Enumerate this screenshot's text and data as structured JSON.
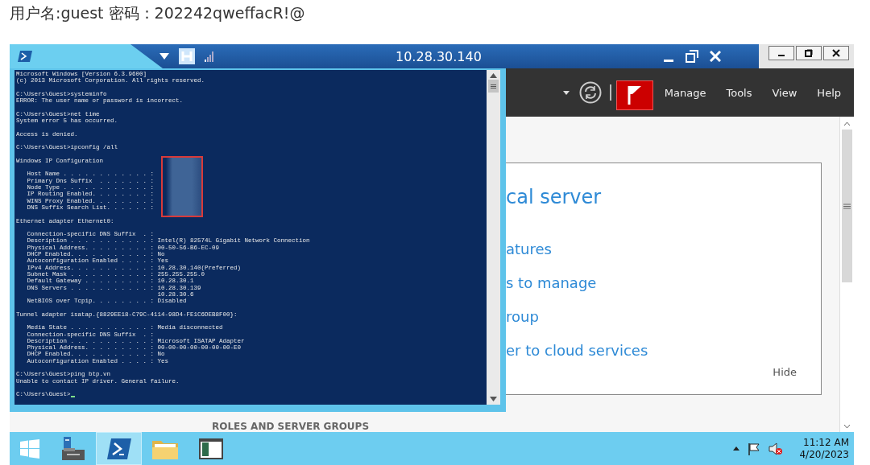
{
  "caption": "用户名:guest 密码：202242qweffacR!@",
  "remote_bar": {
    "title": "10.28.30.140"
  },
  "console": {
    "cursor": true,
    "blocks": [
      {
        "lines": [
          "Microsoft Windows [Version 6.3.9600]",
          "(c) 2013 Microsoft Corporation. All rights reserved."
        ]
      },
      {
        "lines": [
          "C:\\Users\\Guest>systeminfo",
          "ERROR: The user name or password is incorrect."
        ]
      },
      {
        "lines": [
          "C:\\Users\\Guest>net time",
          "System error 5 has occurred."
        ]
      },
      {
        "lines": [
          "Access is denied."
        ]
      },
      {
        "lines": [
          "C:\\Users\\Guest>ipconfig /all"
        ]
      },
      {
        "lines": [
          "Windows IP Configuration"
        ]
      },
      {
        "redacted": true,
        "lines": [
          "   Host Name . . . . . . . . . . . . :",
          "   Primary Dns Suffix  . . . . . . . :",
          "   Node Type . . . . . . . . . . . . :",
          "   IP Routing Enabled. . . . . . . . :",
          "   WINS Proxy Enabled. . . . . . . . :",
          "   DNS Suffix Search List. . . . . . :"
        ]
      },
      {
        "lines": [
          "Ethernet adapter Ethernet0:"
        ]
      },
      {
        "lines": [
          "   Connection-specific DNS Suffix  . :",
          "   Description . . . . . . . . . . . : Intel(R) 82574L Gigabit Network Connection",
          "   Physical Address. . . . . . . . . : 00-50-56-B6-EC-09",
          "   DHCP Enabled. . . . . . . . . . . : No",
          "   Autoconfiguration Enabled . . . . : Yes",
          "   IPv4 Address. . . . . . . . . . . : 10.28.30.140(Preferred)",
          "   Subnet Mask . . . . . . . . . . . : 255.255.255.0",
          "   Default Gateway . . . . . . . . . : 10.28.30.1",
          "   DNS Servers . . . . . . . . . . . : 10.28.30.139",
          "                                       10.28.30.6",
          "   NetBIOS over Tcpip. . . . . . . . : Disabled"
        ]
      },
      {
        "lines": [
          "Tunnel adapter isatap.{8829EE18-C79C-4114-98D4-FE1C6DEB8F00}:"
        ]
      },
      {
        "lines": [
          "   Media State . . . . . . . . . . . : Media disconnected",
          "   Connection-specific DNS Suffix  . :",
          "   Description . . . . . . . . . . . : Microsoft ISATAP Adapter",
          "   Physical Address. . . . . . . . . : 00-00-00-00-00-00-00-E0",
          "   DHCP Enabled. . . . . . . . . . . : No",
          "   Autoconfiguration Enabled . . . . : Yes"
        ]
      },
      {
        "lines": [
          "C:\\Users\\Guest>ping btp.vn",
          "Unable to contact IP driver. General failure."
        ]
      },
      {
        "lines": [
          "C:\\Users\\Guest>"
        ]
      }
    ]
  },
  "server_manager": {
    "menu": [
      "Manage",
      "Tools",
      "View",
      "Help"
    ],
    "welcome": {
      "heading": "cal server",
      "links": [
        "atures",
        "s to manage",
        "roup",
        "er to cloud services"
      ],
      "hide": "Hide"
    },
    "section_heading": "ROLES AND SERVER GROUPS"
  },
  "taskbar": {
    "apps": [
      {
        "kind": "start",
        "selected": false
      },
      {
        "kind": "server-manager",
        "selected": false
      },
      {
        "kind": "powershell",
        "selected": true
      },
      {
        "kind": "explorer",
        "selected": false
      },
      {
        "kind": "window",
        "selected": false
      }
    ],
    "time": "11:12 AM",
    "date": "4/20/2023"
  }
}
